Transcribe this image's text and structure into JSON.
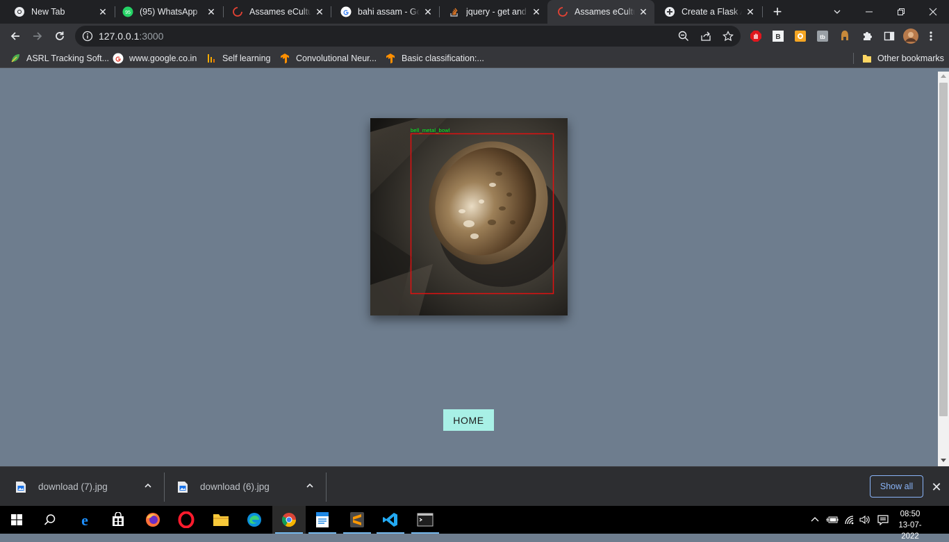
{
  "tabs": [
    {
      "title": "New Tab",
      "icon": "chrome-icon"
    },
    {
      "title": "(95) WhatsApp",
      "icon": "whatsapp-icon",
      "badge": "95"
    },
    {
      "title": "Assames eCulture",
      "icon": "loading-spinner-icon"
    },
    {
      "title": "bahi assam - Google",
      "icon": "google-icon"
    },
    {
      "title": "jquery - get and set",
      "icon": "stackoverflow-icon"
    },
    {
      "title": "Assames eCulture",
      "icon": "loading-spinner-icon",
      "active": true
    },
    {
      "title": "Create a Flask App",
      "icon": "flask-icon"
    }
  ],
  "toolbar": {
    "url_host": "127.0.0.1",
    "url_port": ":3000"
  },
  "bookmarks": [
    {
      "label": "ASRL Tracking Soft...",
      "icon": "leaf-icon"
    },
    {
      "label": "www.google.co.in",
      "icon": "google-icon"
    },
    {
      "label": "Self learning",
      "icon": "chart-bars-icon"
    },
    {
      "label": "Convolutional Neur...",
      "icon": "tensorflow-icon"
    },
    {
      "label": "Basic classification:...",
      "icon": "tensorflow-icon"
    }
  ],
  "other_bookmarks": "Other bookmarks",
  "page": {
    "detection_label": "bell_metal_bowl",
    "home_button": "HOME"
  },
  "downloads": [
    {
      "filename": "download (7).jpg"
    },
    {
      "filename": "download (6).jpg"
    }
  ],
  "show_all": "Show all",
  "clock": {
    "time": "08:50",
    "date": "13-07-2022"
  },
  "colors": {
    "page_background": "#6e7d8e",
    "home_button": "#a8f0e6",
    "detection_box": "#e01010",
    "detection_text": "#00ff22",
    "link_blue": "#8ab4f8"
  }
}
